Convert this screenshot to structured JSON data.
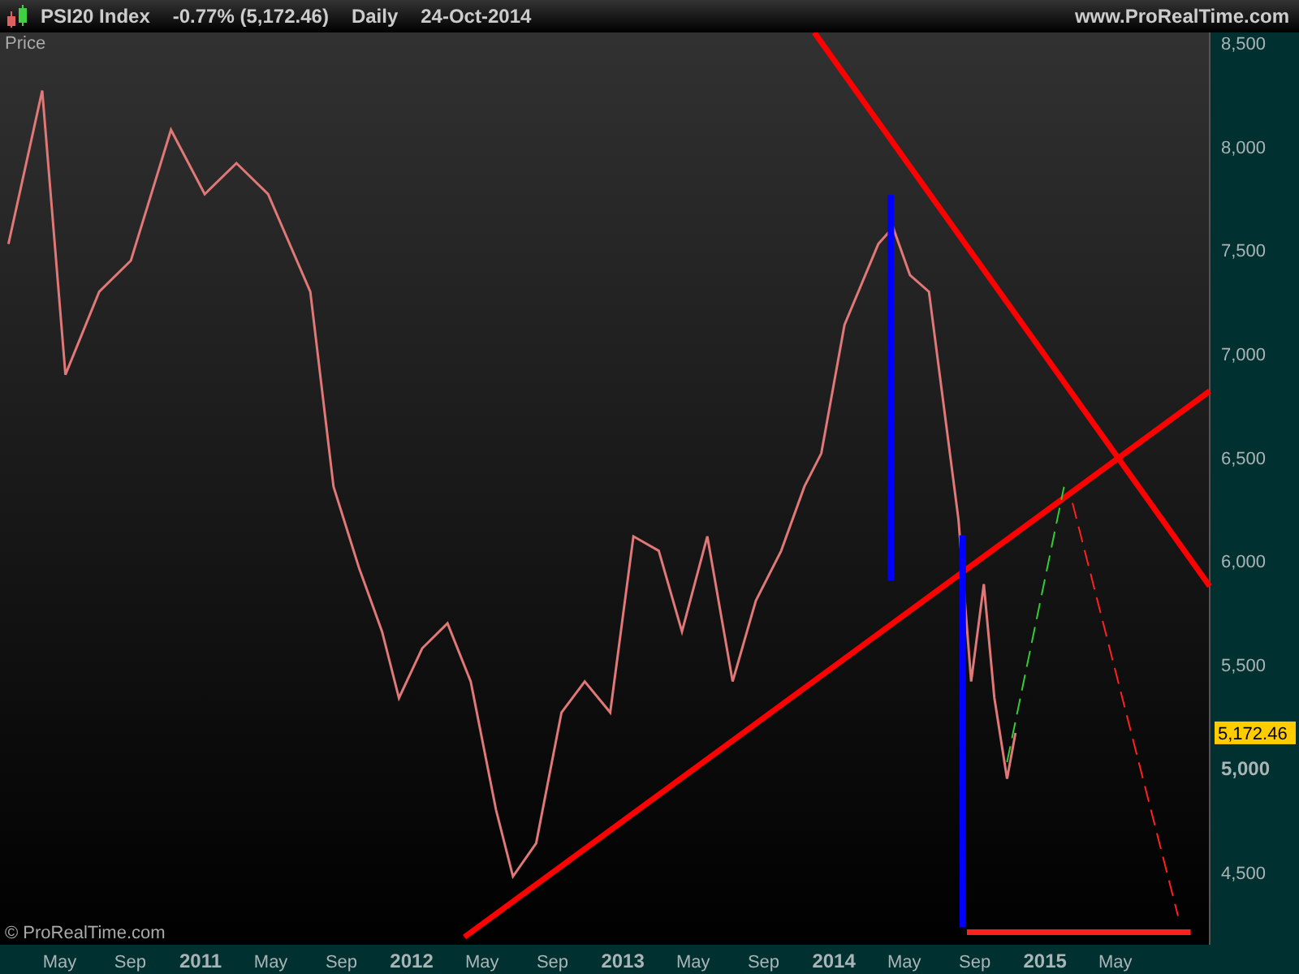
{
  "header": {
    "instrument": "PSI20 Index",
    "change": "-0.77% (5,172.46)",
    "interval": "Daily",
    "date": "24-Oct-2014",
    "website": "www.ProRealTime.com"
  },
  "chart": {
    "panel_label": "Price",
    "copyright": "© ProRealTime.com",
    "last_price": "5,172.46",
    "chart_data": {
      "type": "line",
      "xlim": [
        2010.05,
        2015.78
      ],
      "ylim": [
        4150,
        8550
      ],
      "x": [
        2010.09,
        2010.25,
        2010.36,
        2010.52,
        2010.67,
        2010.86,
        2011.02,
        2011.17,
        2011.32,
        2011.52,
        2011.63,
        2011.75,
        2011.86,
        2011.94,
        2012.05,
        2012.17,
        2012.28,
        2012.4,
        2012.48,
        2012.59,
        2012.71,
        2012.82,
        2012.94,
        2013.05,
        2013.17,
        2013.28,
        2013.4,
        2013.52,
        2013.63,
        2013.75,
        2013.86,
        2013.94,
        2014.05,
        2014.21,
        2014.28,
        2014.36,
        2014.45,
        2014.52,
        2014.59,
        2014.65,
        2014.71,
        2014.76,
        2014.82,
        2014.86
      ],
      "series": [
        {
          "color": "#e07878",
          "values": [
            7530,
            8270,
            6900,
            7300,
            7450,
            8080,
            7770,
            7920,
            7770,
            7300,
            6360,
            5970,
            5660,
            5340,
            5580,
            5700,
            5420,
            4800,
            4480,
            4640,
            5270,
            5420,
            5270,
            6120,
            6050,
            5660,
            6120,
            5420,
            5810,
            6050,
            6360,
            6520,
            7140,
            7530,
            7610,
            7380,
            7300,
            6750,
            6200,
            5420,
            5890,
            5340,
            4950,
            5172
          ]
        }
      ],
      "xticks": [
        {
          "value": 2010.333,
          "label": "May"
        },
        {
          "value": 2010.667,
          "label": "Sep"
        },
        {
          "value": 2011,
          "label": "2011"
        },
        {
          "value": 2011.333,
          "label": "May"
        },
        {
          "value": 2011.667,
          "label": "Sep"
        },
        {
          "value": 2012,
          "label": "2012"
        },
        {
          "value": 2012.333,
          "label": "May"
        },
        {
          "value": 2012.667,
          "label": "Sep"
        },
        {
          "value": 2013,
          "label": "2013"
        },
        {
          "value": 2013.333,
          "label": "May"
        },
        {
          "value": 2013.667,
          "label": "Sep"
        },
        {
          "value": 2014,
          "label": "2014"
        },
        {
          "value": 2014.333,
          "label": "May"
        },
        {
          "value": 2014.667,
          "label": "Sep"
        },
        {
          "value": 2015,
          "label": "2015"
        },
        {
          "value": 2015.333,
          "label": "May"
        }
      ],
      "yticks": [
        {
          "value": 4500,
          "label": "4,500"
        },
        {
          "value": 5000,
          "label": "5,000"
        },
        {
          "value": 5500,
          "label": "5,500"
        },
        {
          "value": 6000,
          "label": "6,000"
        },
        {
          "value": 6500,
          "label": "6,500"
        },
        {
          "value": 7000,
          "label": "7,000"
        },
        {
          "value": 7500,
          "label": "7,500"
        },
        {
          "value": 8000,
          "label": "8,000"
        },
        {
          "value": 8500,
          "label": "8,500"
        }
      ]
    }
  }
}
